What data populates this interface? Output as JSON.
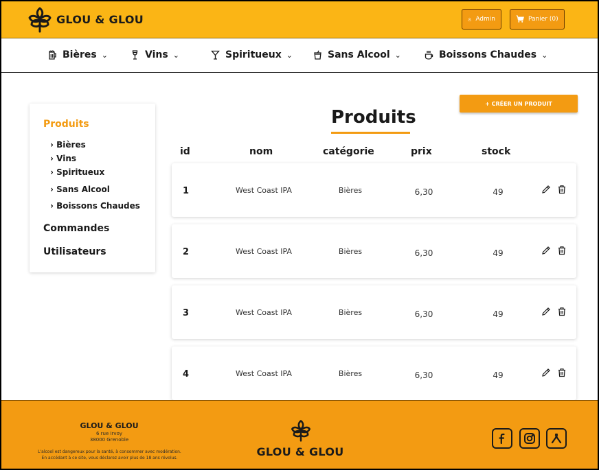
{
  "header": {
    "brand": "GLOU & GLOU",
    "admin_label": "Admin",
    "cart_label": "Panier (0)"
  },
  "categories": [
    {
      "label": "Bières",
      "icon": "beer-icon"
    },
    {
      "label": "Vins",
      "icon": "wine-glass-icon"
    },
    {
      "label": "Spiritueux",
      "icon": "cocktail-icon"
    },
    {
      "label": "Sans Alcool",
      "icon": "soda-cup-icon"
    },
    {
      "label": "Boissons Chaudes",
      "icon": "coffee-cup-icon"
    }
  ],
  "sidebar": {
    "title": "Produits",
    "subitems": [
      "Bières",
      "Vins",
      "Spiritueux",
      "Sans Alcool",
      "Boissons Chaudes"
    ],
    "commandes": "Commandes",
    "utilisateurs": "Utilisateurs"
  },
  "main": {
    "create_button": "+ CRÉER UN PRODUIT",
    "title": "Produits",
    "columns": [
      "id",
      "nom",
      "catégorie",
      "prix",
      "stock"
    ],
    "rows": [
      {
        "id": "1",
        "nom": "West Coast IPA",
        "categorie": "Bières",
        "prix": "6,30",
        "stock": "49"
      },
      {
        "id": "2",
        "nom": "West Coast IPA",
        "categorie": "Bières",
        "prix": "6,30",
        "stock": "49"
      },
      {
        "id": "3",
        "nom": "West Coast IPA",
        "categorie": "Bières",
        "prix": "6,30",
        "stock": "49"
      },
      {
        "id": "4",
        "nom": "West Coast IPA",
        "categorie": "Bières",
        "prix": "6,30",
        "stock": "49"
      }
    ]
  },
  "footer": {
    "brand": "GLOU & GLOU",
    "address_line1": "6 rue Irvoy",
    "address_line2": "38000 Grenoble",
    "warning_line1": "L'alcool est dangereux pour la santé, à consommer avec modération.",
    "warning_line2": "En accédant à ce site, vous déclarez avoir plus de 18 ans révolus.",
    "logo_text": "GLOU & GLOU",
    "socials": [
      "facebook-icon",
      "instagram-icon",
      "untappd-icon"
    ]
  },
  "colors": {
    "header_bg": "#FBB515",
    "accent": "#F39B12"
  }
}
